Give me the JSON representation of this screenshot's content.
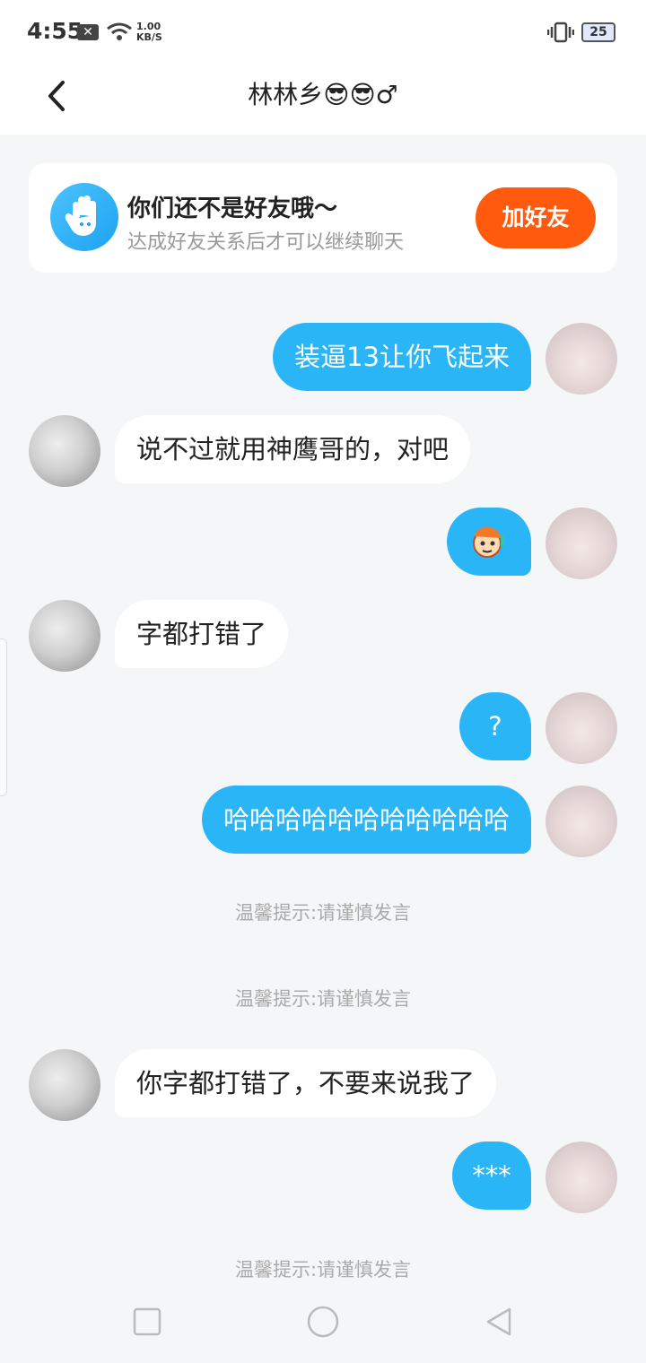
{
  "status_bar": {
    "time": "4:55",
    "close_badge": "✕",
    "net_speed_value": "1.00",
    "net_speed_unit": "KB/S",
    "battery": "25"
  },
  "header": {
    "title": "林林乡😎😎♂"
  },
  "notice": {
    "title": "你们还不是好友哦～",
    "subtitle": "达成好友关系后才可以继续聊天",
    "add_button": "加好友"
  },
  "messages": [
    {
      "side": "out",
      "text": "装逼13让你飞起来"
    },
    {
      "side": "in",
      "text": "说不过就用神鹰哥的，对吧"
    },
    {
      "side": "out",
      "text": "",
      "sticker": "cartoon-face-sticker"
    },
    {
      "side": "in",
      "text": "字都打错了"
    },
    {
      "side": "out",
      "text": "?"
    },
    {
      "side": "out",
      "text": "哈哈哈哈哈哈哈哈哈哈哈"
    },
    {
      "side": "in",
      "text": "你字都打错了，不要来说我了"
    },
    {
      "side": "out",
      "text": "***"
    }
  ],
  "tips": [
    "温馨提示:请谨慎发言",
    "温馨提示:请谨慎发言",
    "温馨提示:请谨慎发言"
  ],
  "colors": {
    "accent_blue": "#2ab5f6",
    "add_button_orange": "#ff5a0d",
    "background": "#f5f6f8"
  },
  "nav": {
    "recent_icon": "square-icon",
    "home_icon": "circle-icon",
    "back_icon": "triangle-back-icon"
  }
}
